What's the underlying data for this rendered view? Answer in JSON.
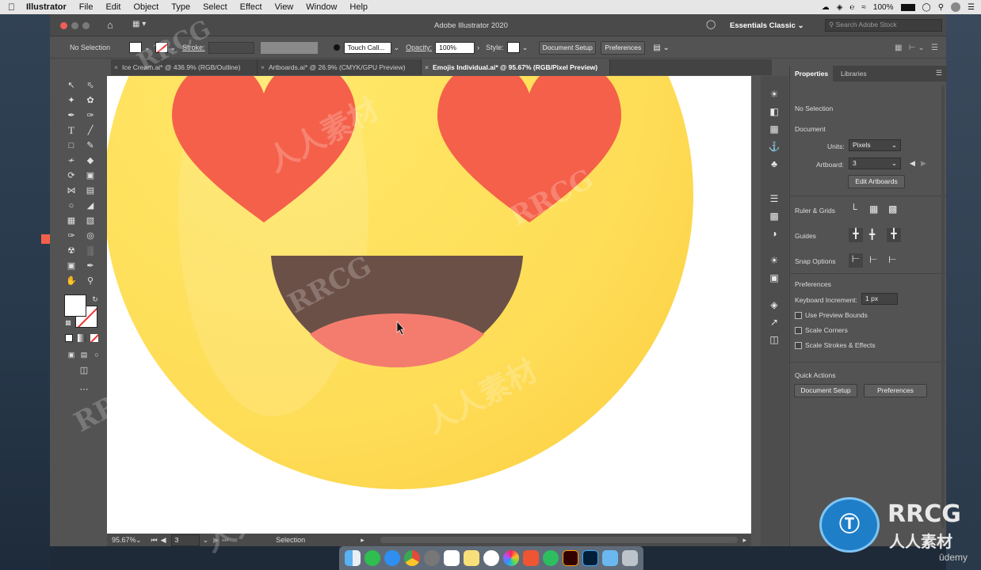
{
  "menubar": {
    "items": [
      "Illustrator",
      "File",
      "Edit",
      "Object",
      "Type",
      "Select",
      "Effect",
      "View",
      "Window",
      "Help"
    ],
    "battery": "100%"
  },
  "window": {
    "title": "Adobe Illustrator 2020",
    "workspace": "Essentials Classic",
    "search_placeholder": "Search Adobe Stock"
  },
  "controlbar": {
    "selection": "No Selection",
    "stroke_label": "Stroke:",
    "brush": "Touch Call...",
    "opacity_label": "Opacity:",
    "opacity_value": "100%",
    "style_label": "Style:",
    "document_setup": "Document Setup",
    "preferences": "Preferences"
  },
  "tabs": [
    {
      "label": "Ice Cream.ai* @ 436.9% (RGB/Outline)",
      "active": false
    },
    {
      "label": "Artboards.ai* @ 26.9% (CMYK/GPU Preview)",
      "active": false
    },
    {
      "label": "Emojis Individual.ai* @ 95.67% (RGB/Pixel Preview)",
      "active": true
    }
  ],
  "statusbar": {
    "zoom": "95.67%",
    "artboard": "3",
    "tool": "Selection"
  },
  "panel": {
    "tabs": [
      "Properties",
      "Libraries"
    ],
    "no_selection": "No Selection",
    "document_heading": "Document",
    "units_label": "Units:",
    "units_value": "Pixels",
    "artboard_label": "Artboard:",
    "artboard_value": "3",
    "edit_artboards": "Edit Artboards",
    "ruler_grids": "Ruler & Grids",
    "guides": "Guides",
    "snap_options": "Snap Options",
    "preferences_heading": "Preferences",
    "keyboard_increment_label": "Keyboard Increment:",
    "keyboard_increment_value": "1 px",
    "use_preview_bounds": "Use Preview Bounds",
    "scale_corners": "Scale Corners",
    "scale_strokes": "Scale Strokes & Effects",
    "quick_actions": "Quick Actions",
    "qa_document_setup": "Document Setup",
    "qa_preferences": "Preferences"
  },
  "watermark": {
    "brand": "RRCG",
    "brand_cn": "人人素材",
    "udemy": "ûdemy"
  },
  "colors": {
    "emoji_face": "#fedd57",
    "heart": "#f5604a",
    "mouth": "#6b5047",
    "tongue": "#f47c6e",
    "accent_tab": "#535353"
  }
}
